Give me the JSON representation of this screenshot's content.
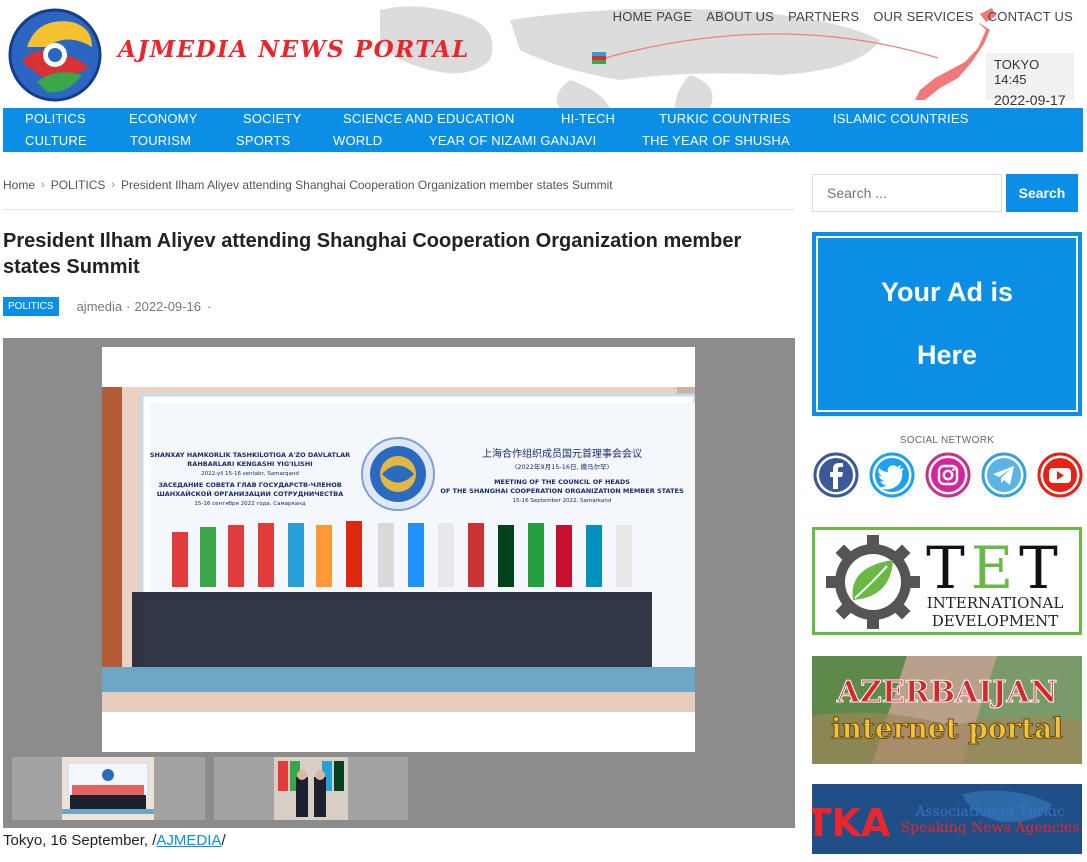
{
  "header": {
    "site_name": "AJMEDIA NEWS PORTAL",
    "top_nav": [
      "HOME PAGE",
      "ABOUT US",
      "PARTNERS",
      "OUR SERVICES",
      "CONTACT US"
    ],
    "clock": {
      "city_time": "TOKYO 14:45",
      "date": "2022-09-17"
    }
  },
  "main_nav": {
    "row1": [
      "POLITICS",
      "ECONOMY",
      "SOCIETY",
      "SCIENCE AND EDUCATION",
      "HI-TECH",
      "TURKIC COUNTRIES",
      "ISLAMIC COUNTRIES"
    ],
    "row2": [
      "CULTURE",
      "TOURISM",
      "SPORTS",
      "WORLD",
      "YEAR OF NIZAMI GANJAVI",
      "THE YEAR OF SHUSHA"
    ]
  },
  "breadcrumb": [
    "Home",
    "POLITICS",
    "President Ilham Aliyev attending Shanghai Cooperation Organization member states Summit"
  ],
  "article": {
    "title": "President Ilham Aliyev attending Shanghai Cooperation Organization member states Summit",
    "category": "POLITICS",
    "author": "ajmedia",
    "date": "2022-09-16",
    "dot": "·",
    "dateline_prefix": "Tokyo, 16 September, /",
    "dateline_link": "AJMEDIA",
    "dateline_suffix": "/"
  },
  "photo_banner": {
    "left": [
      "SHANXAY HAMKORLIK TASHKILOTIGA A'ZO DAVLATLAR",
      "RAHBARLARI KENGASHI YIG'ILISHI",
      "2022-yil 15-16 sentabr, Samarqand",
      "ЗАСЕДАНИЕ СОВЕТА ГЛАВ ГОСУДАРСТВ-ЧЛЕНОВ",
      "ШАНХАЙСКОЙ ОРГАНИЗАЦИИ СОТРУДНИЧЕСТВА",
      "15-16 сентября 2022 года, Самарканд"
    ],
    "right": [
      "上海合作组织成员国元首理事会会议",
      "(2022年9月15-16日, 撒马尔罕)",
      "MEETING OF THE COUNCIL OF HEADS",
      "OF THE SHANGHAI COOPERATION ORGANIZATION MEMBER STATES",
      "15-16 September 2022, Samarkand"
    ]
  },
  "sidebar": {
    "search_placeholder": "Search ...",
    "search_button": "Search",
    "ad_line1": "Your Ad is",
    "ad_line2": "Here",
    "social_title": "SOCIAL NETWORK",
    "social_icons": [
      "facebook-icon",
      "twitter-icon",
      "instagram-icon",
      "telegram-icon",
      "youtube-icon"
    ],
    "tet": {
      "letters": "TET",
      "line1": "INTERNATIONAL",
      "line2": "DEVELOPMENT"
    },
    "aip": {
      "line1": "AZERBAIJAN",
      "line2": "internet portal"
    },
    "atsna": {
      "abbr": "TKA",
      "line1": "Association of Turkic",
      "line2": "Speaking News Agencies"
    }
  },
  "colors": {
    "accent": "#0b8ee6",
    "brand_red": "#e8262b",
    "tet_green": "#6ab845"
  }
}
